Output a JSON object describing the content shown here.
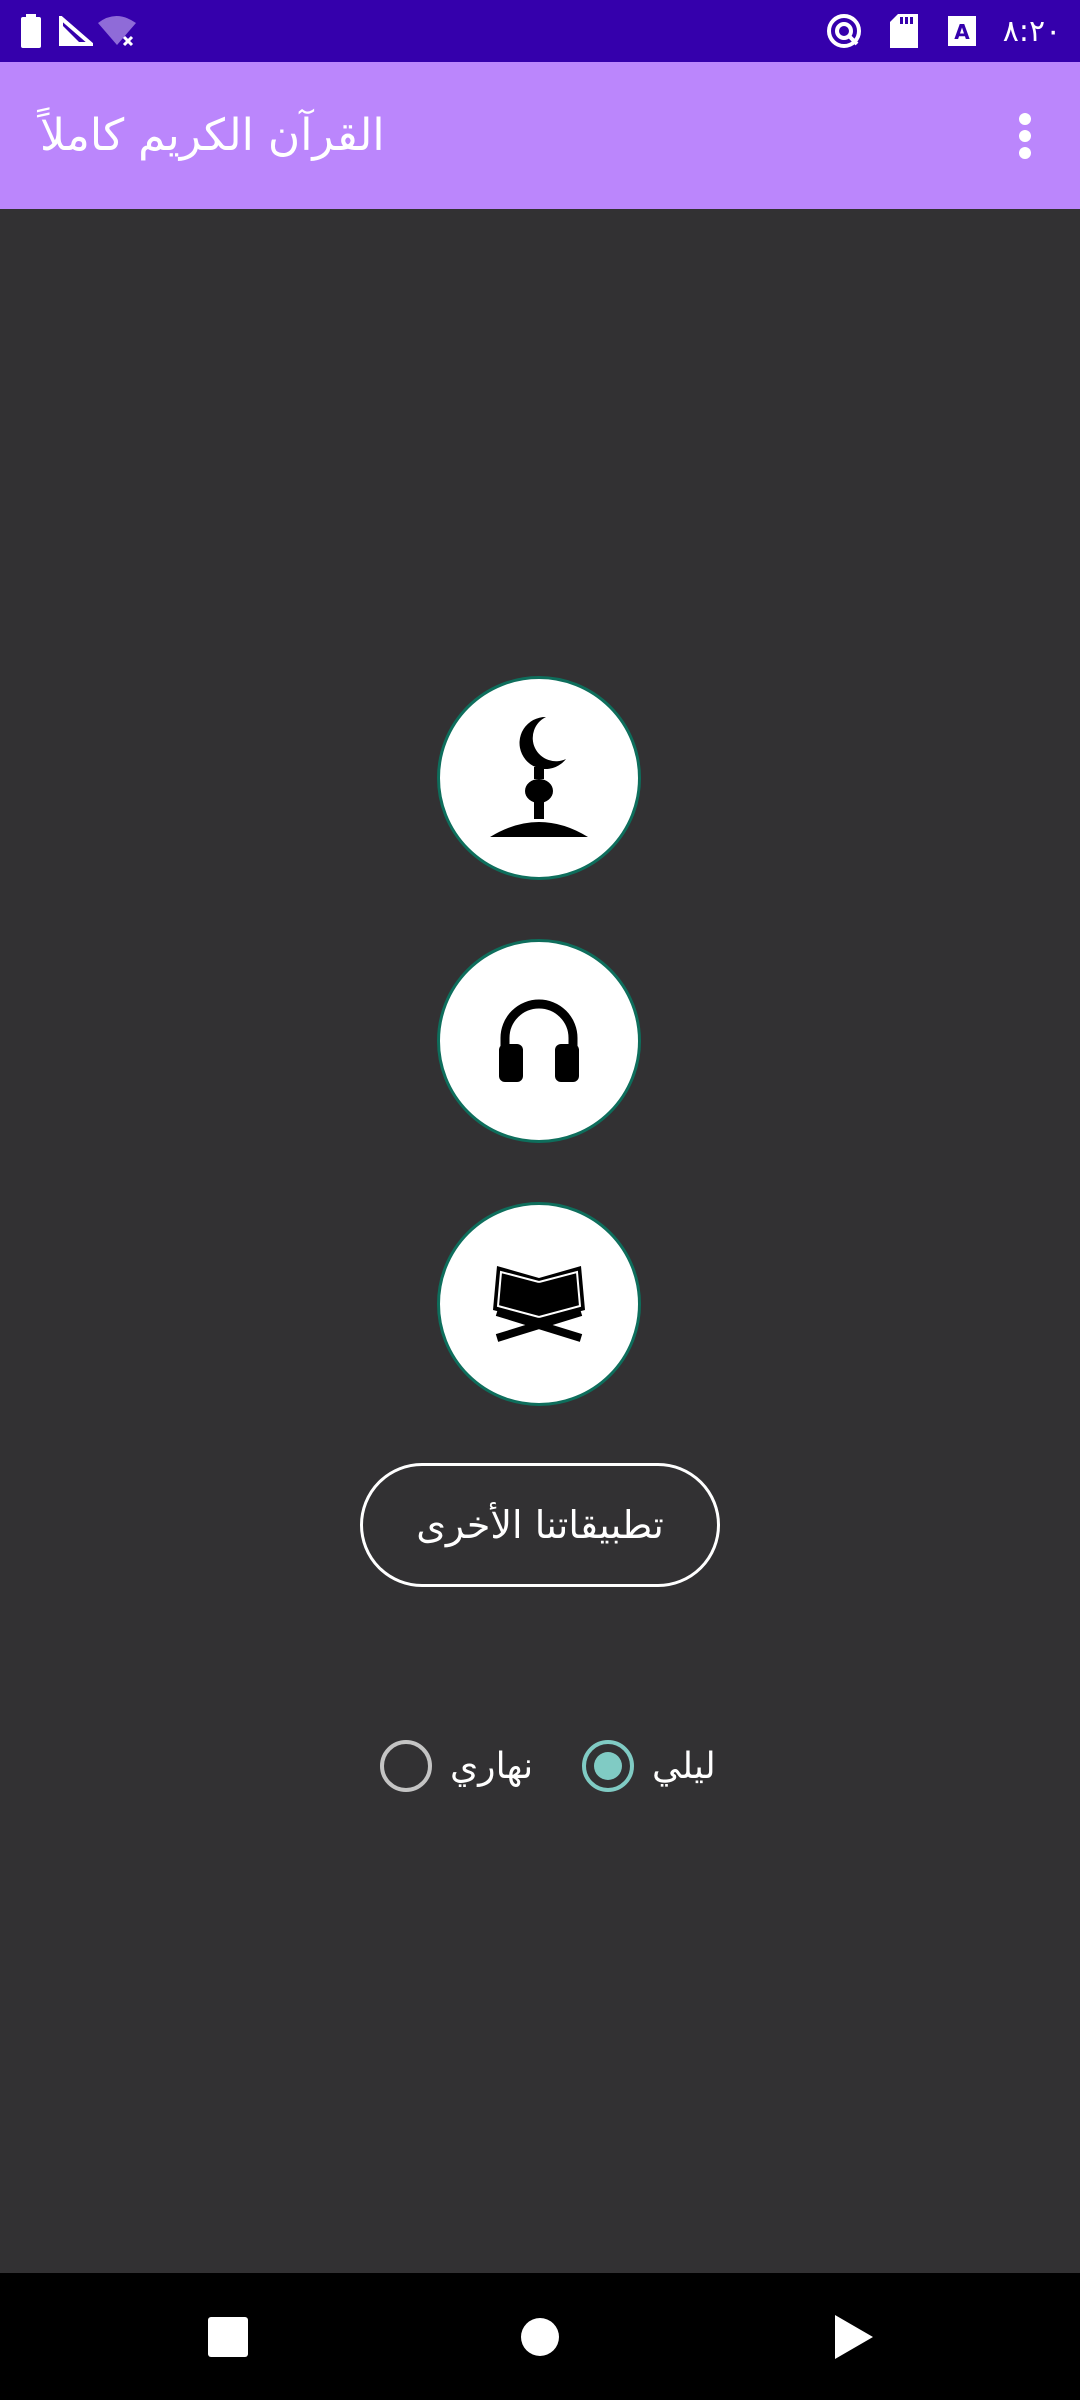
{
  "status_bar": {
    "time": "٨:٢٠",
    "icons": [
      "battery-icon",
      "signal-icon",
      "wifi-off-icon",
      "sync-icon",
      "sd-card-icon",
      "keyboard-a-icon"
    ],
    "background": "#3500ac"
  },
  "app_bar": {
    "title": "القرآن الكريم كاملاً",
    "menu_icon": "more-vert-icon",
    "background": "#bb86fc"
  },
  "main": {
    "buttons": [
      {
        "icon": "mosque-crescent-icon"
      },
      {
        "icon": "headphones-icon"
      },
      {
        "icon": "open-quran-icon"
      }
    ],
    "other_apps_label": "تطبيقاتنا الأخرى",
    "theme": {
      "options": [
        {
          "label": "ليلي",
          "selected": true
        },
        {
          "label": "نهاري",
          "selected": false
        }
      ],
      "selected_color": "#80cbc4"
    },
    "background": "#323133"
  },
  "nav_bar": {
    "buttons": [
      "recents-square-icon",
      "home-circle-icon",
      "back-triangle-icon"
    ]
  }
}
